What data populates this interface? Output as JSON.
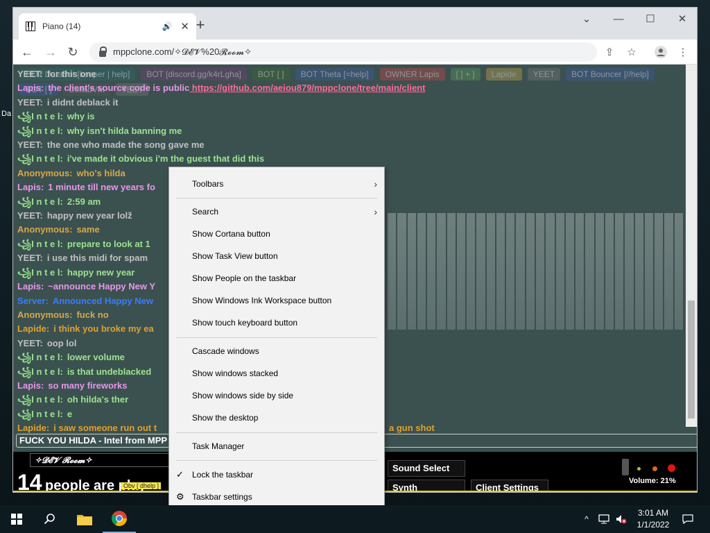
{
  "desktop": {
    "label": "Da"
  },
  "browser": {
    "tab_title": "Piano (14)",
    "new_tab_symbol": "+",
    "url": "mppclone.com/✧𝓓𝓔𝓥%20𝓡𝓸𝓸𝓶✧"
  },
  "userlist": [
    "BOT DataBot [keeper | help]",
    "BOT [discord.gg/k4rLgha]",
    "BOT [ ]",
    "BOT Theta [=help]",
    "OWNER Lapis",
    "[ ] + ]",
    "Lapide",
    "YEET",
    "BOT Bouncer [//help]",
    "BOT [ ]",
    "CollabVM",
    "YEET"
  ],
  "chat": {
    "colors": {
      "intel": "#9be38f",
      "yeet": "#c0c0c0",
      "anon": "#d8a84a",
      "lapis": "#e896e8",
      "lapide": "#e0a030",
      "server": "#3b7bff",
      "link": "#ff6a9a"
    },
    "lines": [
      {
        "name": "YEET:",
        "text": "for this one",
        "c": "yeet"
      },
      {
        "name": "Lapis:",
        "text": "the client's source code is public",
        "link": "https://github.com/aeiou879/mppclone/tree/main/client",
        "c": "lapis"
      },
      {
        "name": "YEET:",
        "text": "i didnt deblack it",
        "c": "yeet"
      },
      {
        "name": "꧁I n t e l:",
        "text": "why is",
        "c": "intel"
      },
      {
        "name": "꧁I n t e l:",
        "text": "why isn't hilda banning me",
        "c": "intel"
      },
      {
        "name": "YEET:",
        "text": "the one who made the song gave me",
        "c": "yeet"
      },
      {
        "name": "꧁I n t e l:",
        "text": "i've made it obvious i'm the guest that did this",
        "c": "intel"
      },
      {
        "name": "Anonymous:",
        "text": "who's hilda",
        "c": "anon"
      },
      {
        "name": "Lapis:",
        "text": "1 minute till new years fo",
        "c": "lapis"
      },
      {
        "name": "꧁I n t e l:",
        "text": "2:59 am",
        "c": "intel"
      },
      {
        "name": "YEET:",
        "text": "happy new year lolž",
        "c": "yeet"
      },
      {
        "name": "Anonymous:",
        "text": "same",
        "c": "anon"
      },
      {
        "name": "꧁I n t e l:",
        "text": "prepare to look at 1",
        "c": "intel"
      },
      {
        "name": "YEET:",
        "text": "i use this midi for spam",
        "c": "yeet"
      },
      {
        "name": "꧁I n t e l:",
        "text": "happy new year",
        "c": "intel"
      },
      {
        "name": "Lapis:",
        "text": "~announce Happy New Y",
        "c": "lapis"
      },
      {
        "name": "Server:",
        "text": "Announced Happy New",
        "c": "server"
      },
      {
        "name": "Anonymous:",
        "text": "fuck no",
        "c": "anon"
      },
      {
        "name": "Lapide:",
        "text": "i think you broke my ea",
        "c": "lapide"
      },
      {
        "name": "YEET:",
        "text": "oop lol",
        "c": "yeet"
      },
      {
        "name": "꧁I n t e l:",
        "text": "lower volume",
        "c": "intel"
      },
      {
        "name": "꧁I n t e l:",
        "text": "is that undeblacked",
        "c": "intel"
      },
      {
        "name": "Lapis:",
        "text": "so many fireworks",
        "c": "lapis"
      },
      {
        "name": "꧁I n t e l:",
        "text": "oh hilda's ther",
        "c": "intel"
      },
      {
        "name": "꧁I n t e l:",
        "text": "e",
        "c": "intel"
      },
      {
        "name": "Lapide:",
        "text": "i saw someone run out t",
        "tail": "a gun shot",
        "c": "lapide"
      }
    ],
    "input_value": "FUCK YOU HILDA - Intel from MPP"
  },
  "piano_bar": {
    "room": "✧𝓓𝓔𝓥 𝓡𝓸𝓸𝓶✧",
    "count": "14",
    "count_text": "people are play",
    "sound_select": "Sound Select",
    "synth": "Synth",
    "client_settings": "Client Settings",
    "volume": "Volume: 21%",
    "tooltip": "Obv [ dhelp ]"
  },
  "context_menu": {
    "toolbars": "Toolbars",
    "search": "Search",
    "cortana": "Show Cortana button",
    "task_view": "Show Task View button",
    "people": "Show People on the taskbar",
    "ink": "Show Windows Ink Workspace button",
    "touch_kb": "Show touch keyboard button",
    "cascade": "Cascade windows",
    "stacked": "Show windows stacked",
    "side_by_side": "Show windows side by side",
    "desktop": "Show the desktop",
    "task_manager": "Task Manager",
    "lock": "Lock the taskbar",
    "settings": "Taskbar settings"
  },
  "taskbar": {
    "time": "3:01 AM",
    "date": "1/1/2022"
  }
}
